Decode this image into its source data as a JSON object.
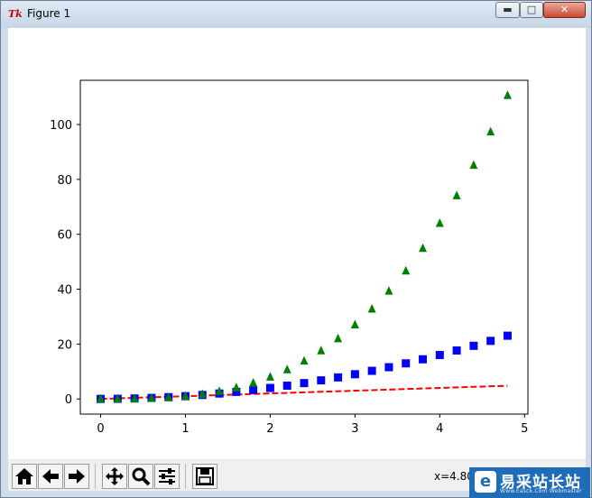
{
  "window": {
    "title": "Figure 1",
    "app_icon": "tk-feather-icon"
  },
  "window_controls": {
    "min_icon": "minimize-icon",
    "max_icon": "maximize-icon",
    "close_icon": "close-icon"
  },
  "toolbar": {
    "buttons": [
      "home-icon",
      "back-arrow-icon",
      "forward-arrow-icon",
      "pan-move-icon",
      "zoom-magnifier-icon",
      "subplots-config-icon",
      "save-floppy-icon"
    ],
    "coordinate_readout": "x=4.805"
  },
  "watermark": {
    "text": "易采站长站",
    "sub": "Www.Easck.Com  Webmaster"
  },
  "chart_data": {
    "type": "line",
    "title": "",
    "xlabel": "",
    "ylabel": "",
    "xlim": [
      -0.24,
      5.04
    ],
    "ylim": [
      -5.53,
      116.11
    ],
    "x_ticks": [
      "0",
      "1",
      "2",
      "3",
      "4",
      "5"
    ],
    "y_ticks": [
      "0",
      "20",
      "40",
      "60",
      "80",
      "100"
    ],
    "grid": false,
    "legend": "none",
    "x": [
      0.0,
      0.2,
      0.4,
      0.6,
      0.8,
      1.0,
      1.2,
      1.4,
      1.6,
      1.8,
      2.0,
      2.2,
      2.4,
      2.6,
      2.8,
      3.0,
      3.2,
      3.4,
      3.6,
      3.8,
      4.0,
      4.2,
      4.4,
      4.6,
      4.8
    ],
    "series": [
      {
        "style": "red-dashed",
        "color": "#ff0000",
        "marker": "none",
        "values": [
          0.0,
          0.2,
          0.4,
          0.6,
          0.8,
          1.0,
          1.2,
          1.4,
          1.6,
          1.8,
          2.0,
          2.2,
          2.4,
          2.6,
          2.8,
          3.0,
          3.2,
          3.4,
          3.6,
          3.8,
          4.0,
          4.2,
          4.4,
          4.6,
          4.8
        ]
      },
      {
        "style": "blue-squares",
        "color": "#0000ff",
        "marker": "square",
        "values": [
          0.0,
          0.04,
          0.16,
          0.36,
          0.64,
          1.0,
          1.44,
          1.96,
          2.56,
          3.24,
          4.0,
          4.84,
          5.76,
          6.76,
          7.84,
          9.0,
          10.24,
          11.56,
          12.96,
          14.44,
          16.0,
          17.64,
          19.36,
          21.16,
          23.04
        ]
      },
      {
        "style": "green-triangles",
        "color": "#008000",
        "marker": "triangle",
        "values": [
          0.0,
          0.008,
          0.064,
          0.216,
          0.512,
          1.0,
          1.728,
          2.744,
          4.096,
          5.832,
          8.0,
          10.648,
          13.824,
          17.576,
          21.952,
          27.0,
          32.768,
          39.304,
          46.656,
          54.872,
          64.0,
          74.088,
          85.184,
          97.336,
          110.592
        ]
      }
    ]
  }
}
